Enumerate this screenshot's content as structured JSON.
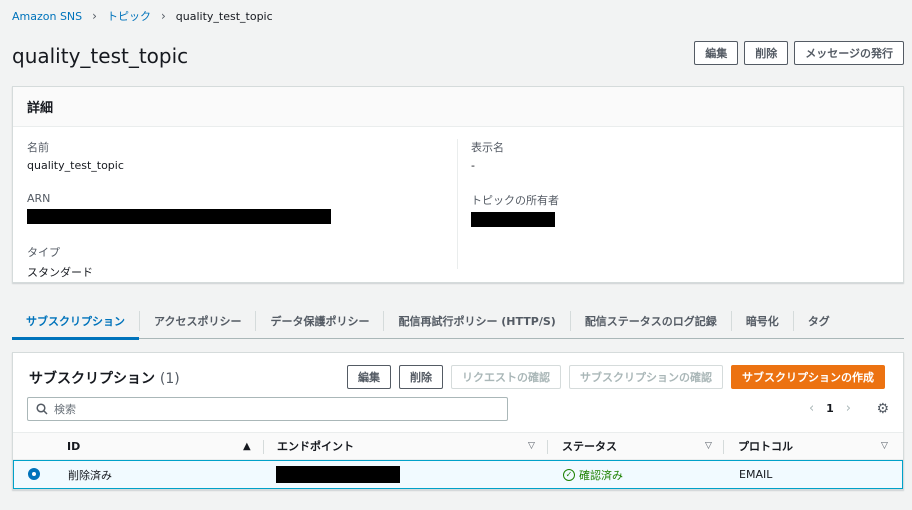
{
  "breadcrumb": {
    "items": [
      "Amazon SNS",
      "トピック",
      "quality_test_topic"
    ]
  },
  "page": {
    "title": "quality_test_topic"
  },
  "top_actions": {
    "edit": "編集",
    "delete": "削除",
    "publish": "メッセージの発行"
  },
  "details": {
    "header": "詳細",
    "name_label": "名前",
    "name_value": "quality_test_topic",
    "arn_label": "ARN",
    "type_label": "タイプ",
    "type_value": "スタンダード",
    "display_name_label": "表示名",
    "display_name_value": "-",
    "owner_label": "トピックの所有者"
  },
  "tabs": [
    {
      "label": "サブスクリプション",
      "active": true
    },
    {
      "label": "アクセスポリシー"
    },
    {
      "label": "データ保護ポリシー"
    },
    {
      "label": "配信再試行ポリシー (HTTP/S)"
    },
    {
      "label": "配信ステータスのログ記録"
    },
    {
      "label": "暗号化"
    },
    {
      "label": "タグ"
    }
  ],
  "subscriptions": {
    "title": "サブスクリプション",
    "count": "(1)",
    "actions": {
      "edit": "編集",
      "delete": "削除",
      "request_confirm": "リクエストの確認",
      "subscription_confirm": "サブスクリプションの確認",
      "create": "サブスクリプションの作成"
    },
    "search_placeholder": "検索",
    "page": "1",
    "columns": [
      "ID",
      "エンドポイント",
      "ステータス",
      "プロトコル"
    ],
    "rows": [
      {
        "id": "削除済み",
        "status": "確認済み",
        "protocol": "EMAIL"
      }
    ]
  },
  "colors": {
    "accent": "#0073bb",
    "primary_button": "#ec7211",
    "success": "#1d8102"
  }
}
